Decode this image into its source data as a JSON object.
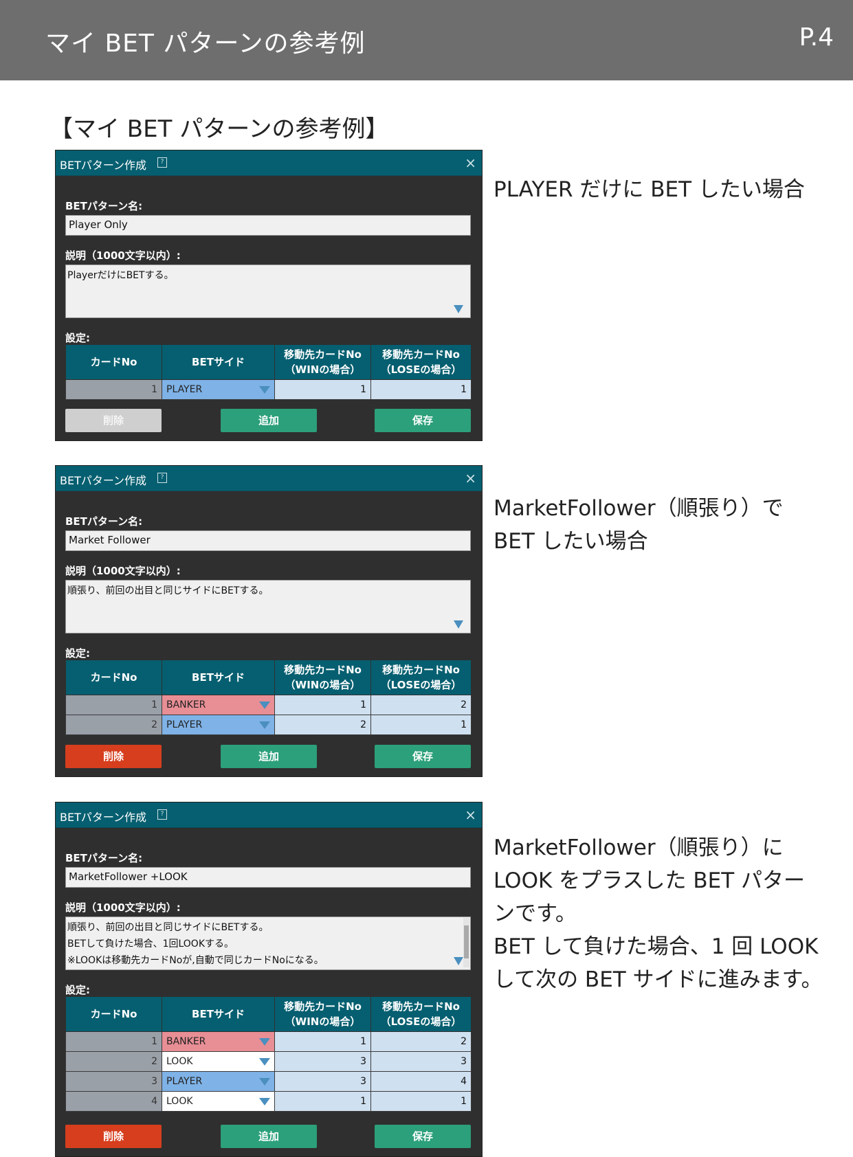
{
  "header": {
    "title": "マイ BET パターンの参考例",
    "page": "P.4"
  },
  "section_title": "【マイ BET パターンの参考例】",
  "panels": [
    {
      "title": "BETパターン作成",
      "name_label": "BETパターン名:",
      "name_value": "Player Only",
      "desc_label": "説明（1000文字以内）:",
      "desc_lines": [
        "PlayerだけにBETする。"
      ],
      "settings_label": "設定:",
      "headers": [
        "カードNo",
        "BETサイド",
        "移動先カードNo\n（WINの場合）",
        "移動先カードNo\n（LOSEの場合）"
      ],
      "rows": [
        {
          "no": "1",
          "side": "PLAYER",
          "win": "1",
          "lose": "1"
        }
      ],
      "buttons": {
        "delete": "削除",
        "add": "追加",
        "save": "保存"
      },
      "caption_lines": [
        "PLAYER だけに BET したい場合"
      ]
    },
    {
      "title": "BETパターン作成",
      "name_label": "BETパターン名:",
      "name_value": "Market Follower",
      "desc_label": "説明（1000文字以内）:",
      "desc_lines": [
        "順張り、前回の出目と同じサイドにBETする。"
      ],
      "settings_label": "設定:",
      "headers": [
        "カードNo",
        "BETサイド",
        "移動先カードNo\n（WINの場合）",
        "移動先カードNo\n（LOSEの場合）"
      ],
      "rows": [
        {
          "no": "1",
          "side": "BANKER",
          "win": "1",
          "lose": "2"
        },
        {
          "no": "2",
          "side": "PLAYER",
          "win": "2",
          "lose": "1"
        }
      ],
      "buttons": {
        "delete": "削除",
        "add": "追加",
        "save": "保存"
      },
      "caption_lines": [
        "MarketFollower（順張り）で",
        "BET したい場合"
      ]
    },
    {
      "title": "BETパターン作成",
      "name_label": "BETパターン名:",
      "name_value": "MarketFollower +LOOK",
      "desc_label": "説明（1000文字以内）:",
      "desc_lines": [
        "順張り、前回の出目と同じサイドにBETする。",
        "BETして負けた場合、1回LOOKする。",
        "※LOOKは移動先カードNoが,自動で同じカードNoになる。"
      ],
      "settings_label": "設定:",
      "headers": [
        "カードNo",
        "BETサイド",
        "移動先カードNo\n（WINの場合）",
        "移動先カードNo\n（LOSEの場合）"
      ],
      "rows": [
        {
          "no": "1",
          "side": "BANKER",
          "win": "1",
          "lose": "2"
        },
        {
          "no": "2",
          "side": "LOOK",
          "win": "3",
          "lose": "3"
        },
        {
          "no": "3",
          "side": "PLAYER",
          "win": "3",
          "lose": "4"
        },
        {
          "no": "4",
          "side": "LOOK",
          "win": "1",
          "lose": "1"
        }
      ],
      "buttons": {
        "delete": "削除",
        "add": "追加",
        "save": "保存"
      },
      "caption_lines": [
        "MarketFollower（順張り）に",
        "LOOK をプラスした BET パター",
        "ンです。",
        "BET して負けた場合、1 回 LOOK",
        "して次の BET サイドに進みます。"
      ]
    }
  ]
}
